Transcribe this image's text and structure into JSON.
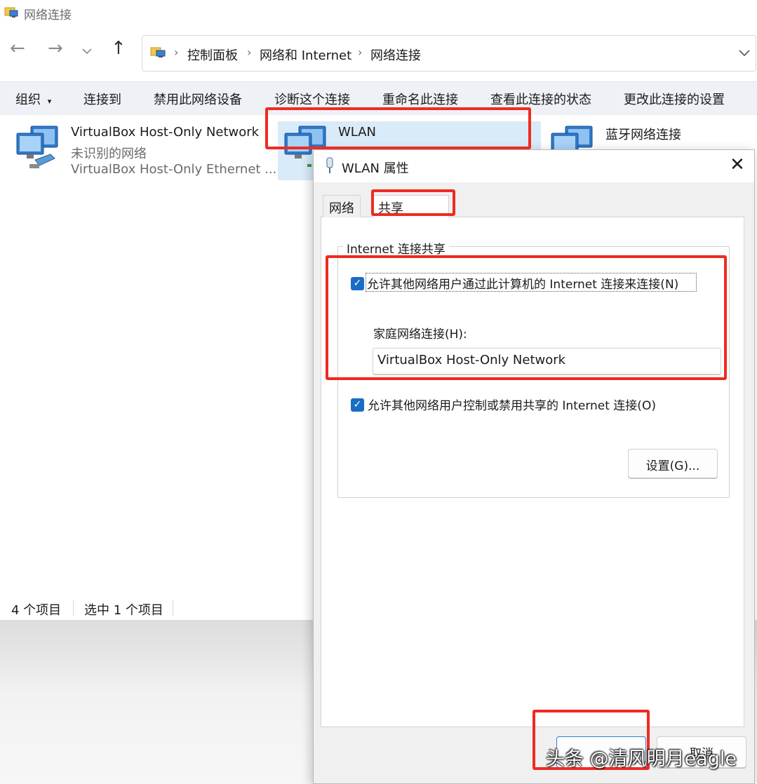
{
  "window": {
    "title": "网络连接",
    "breadcrumb": [
      "控制面板",
      "网络和 Internet",
      "网络连接"
    ]
  },
  "navigation": {
    "back_icon": "arrow-left-icon",
    "forward_icon": "arrow-right-icon",
    "recent_icon": "chevron-down-icon",
    "up_icon": "arrow-up-icon"
  },
  "toolbar": {
    "organize": "组织",
    "items": [
      "连接到",
      "禁用此网络设备",
      "诊断这个连接",
      "重命名此连接",
      "查看此连接的状态",
      "更改此连接的设置"
    ]
  },
  "connections": [
    {
      "name": "VirtualBox Host-Only Network",
      "status": "未识别的网络",
      "device": "VirtualBox Host-Only Ethernet ...",
      "icon": "network-adapter-icon"
    },
    {
      "name": "WLAN",
      "icon": "network-adapter-icon",
      "selected": true
    },
    {
      "name": "蓝牙网络连接",
      "icon": "network-adapter-icon"
    }
  ],
  "status_bar": {
    "count": "4 个项目",
    "selection": "选中 1 个项目"
  },
  "dialog": {
    "title": "WLAN 属性",
    "icon": "network-adapter-small-icon",
    "tabs": [
      "网络",
      "共享"
    ],
    "active_tab": "共享",
    "group_title": "Internet 连接共享",
    "allow_sharing": {
      "label": "允许其他网络用户通过此计算机的 Internet 连接来连接(N)",
      "checked": true
    },
    "home_network": {
      "label": "家庭网络连接(H):",
      "value": "VirtualBox Host-Only Network"
    },
    "allow_control": {
      "label": "允许其他网络用户控制或禁用共享的 Internet 连接(O)",
      "checked": true
    },
    "settings_button": "设置(G)...",
    "cancel_button": "取消"
  },
  "accent_color": "#1a6dc4",
  "annotation_color": "#ee2b22",
  "watermark": "头条 @清风明月eagle"
}
